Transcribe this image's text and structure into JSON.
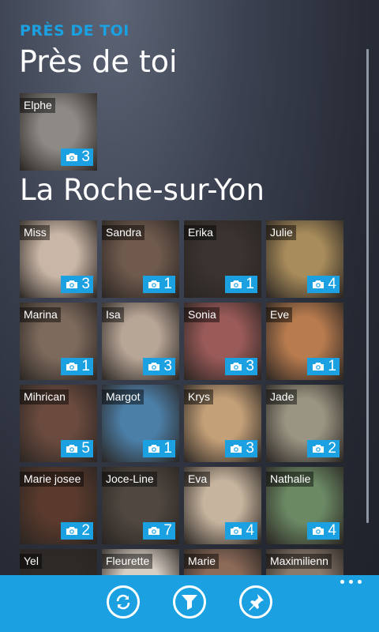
{
  "app_title": "PRÈS DE TOI",
  "page_title": "Près de toi",
  "nearby": [
    {
      "name": "Elphe",
      "photos": "3",
      "color": "#8d8a86"
    }
  ],
  "section_title": "La Roche-sur-Yon",
  "people": [
    {
      "name": "Miss",
      "photos": "3",
      "color": "#c9b6a6"
    },
    {
      "name": "Sandra",
      "photos": "1",
      "color": "#6f5a4d"
    },
    {
      "name": "Erika",
      "photos": "1",
      "color": "#3a3330"
    },
    {
      "name": "Julie",
      "photos": "4",
      "color": "#a88c5b"
    },
    {
      "name": "Marina",
      "photos": "1",
      "color": "#7d6a5c"
    },
    {
      "name": "Isa",
      "photos": "3",
      "color": "#b7a596"
    },
    {
      "name": "Sonia",
      "photos": "3",
      "color": "#9a5a58"
    },
    {
      "name": "Eve",
      "photos": "1",
      "color": "#b77b4e"
    },
    {
      "name": "Mihrican",
      "photos": "5",
      "color": "#6b4b3e"
    },
    {
      "name": "Margot",
      "photos": "1",
      "color": "#4c7fa8"
    },
    {
      "name": "Krys",
      "photos": "3",
      "color": "#c4a078"
    },
    {
      "name": "Jade",
      "photos": "2",
      "color": "#9a9582"
    },
    {
      "name": "Marie josee",
      "photos": "2",
      "color": "#5a3a2c"
    },
    {
      "name": "Joce-Line",
      "photos": "7",
      "color": "#4f4740"
    },
    {
      "name": "Eva",
      "photos": "4",
      "color": "#c6b49e"
    },
    {
      "name": "Nathalie",
      "photos": "4",
      "color": "#6b8a64"
    },
    {
      "name": "Yel",
      "photos": "",
      "color": "#2e2a28"
    },
    {
      "name": "Fleurette",
      "photos": "",
      "color": "#d8cfc4"
    },
    {
      "name": "Marie",
      "photos": "",
      "color": "#8c6a58"
    },
    {
      "name": "Maximilienn",
      "photos": "",
      "color": "#8a7a6c"
    }
  ],
  "appbar": {
    "color": "#1ba1e2",
    "buttons": [
      {
        "icon": "refresh-icon"
      },
      {
        "icon": "filter-icon"
      },
      {
        "icon": "pin-icon"
      }
    ]
  },
  "accent": "#1ba1e2"
}
